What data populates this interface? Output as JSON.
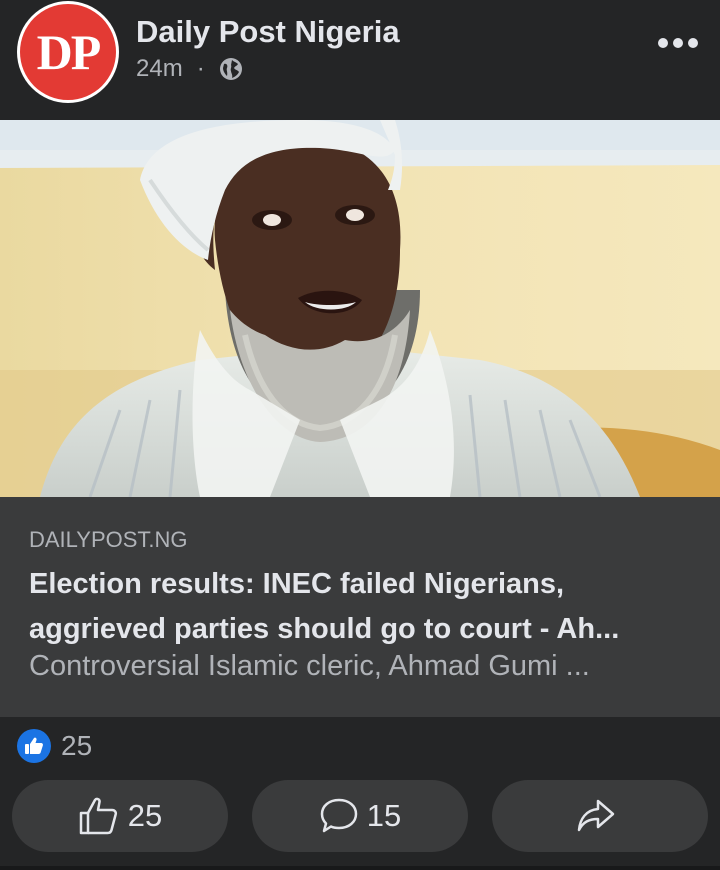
{
  "post": {
    "page_name": "Daily Post Nigeria",
    "avatar_text": "DP",
    "time": "24m",
    "separator": "·"
  },
  "link": {
    "domain": "DAILYPOST.NG",
    "headline": "Election results: INEC failed Nigerians, aggrieved parties should go to court - Ah...",
    "description": "Controversial Islamic cleric, Ahmad Gumi ..."
  },
  "reactions": {
    "count": "25"
  },
  "actions": {
    "like_count": "25",
    "comment_count": "15"
  },
  "colors": {
    "brand_red": "#e33a34",
    "like_blue": "#1b74e4"
  }
}
